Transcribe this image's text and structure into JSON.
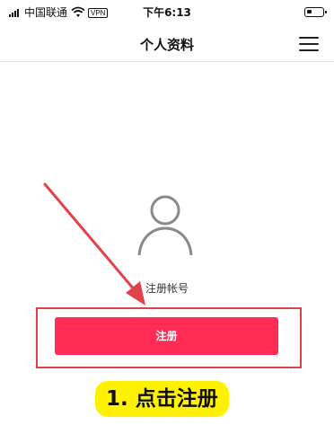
{
  "status_bar": {
    "carrier": "中国联通",
    "vpn": "VPN",
    "time": "下午6:13"
  },
  "navbar": {
    "title": "个人资料",
    "menu_icon": "hamburger-menu-icon"
  },
  "profile": {
    "avatar_icon": "user-avatar-icon",
    "register_account_label": "注册帐号"
  },
  "actions": {
    "register_button": "注册"
  },
  "annotation": {
    "instruction": "1. 点击注册",
    "highlight_color": "#e0414b",
    "instruction_bg": "#fff200"
  },
  "colors": {
    "accent": "#ff2c56"
  }
}
